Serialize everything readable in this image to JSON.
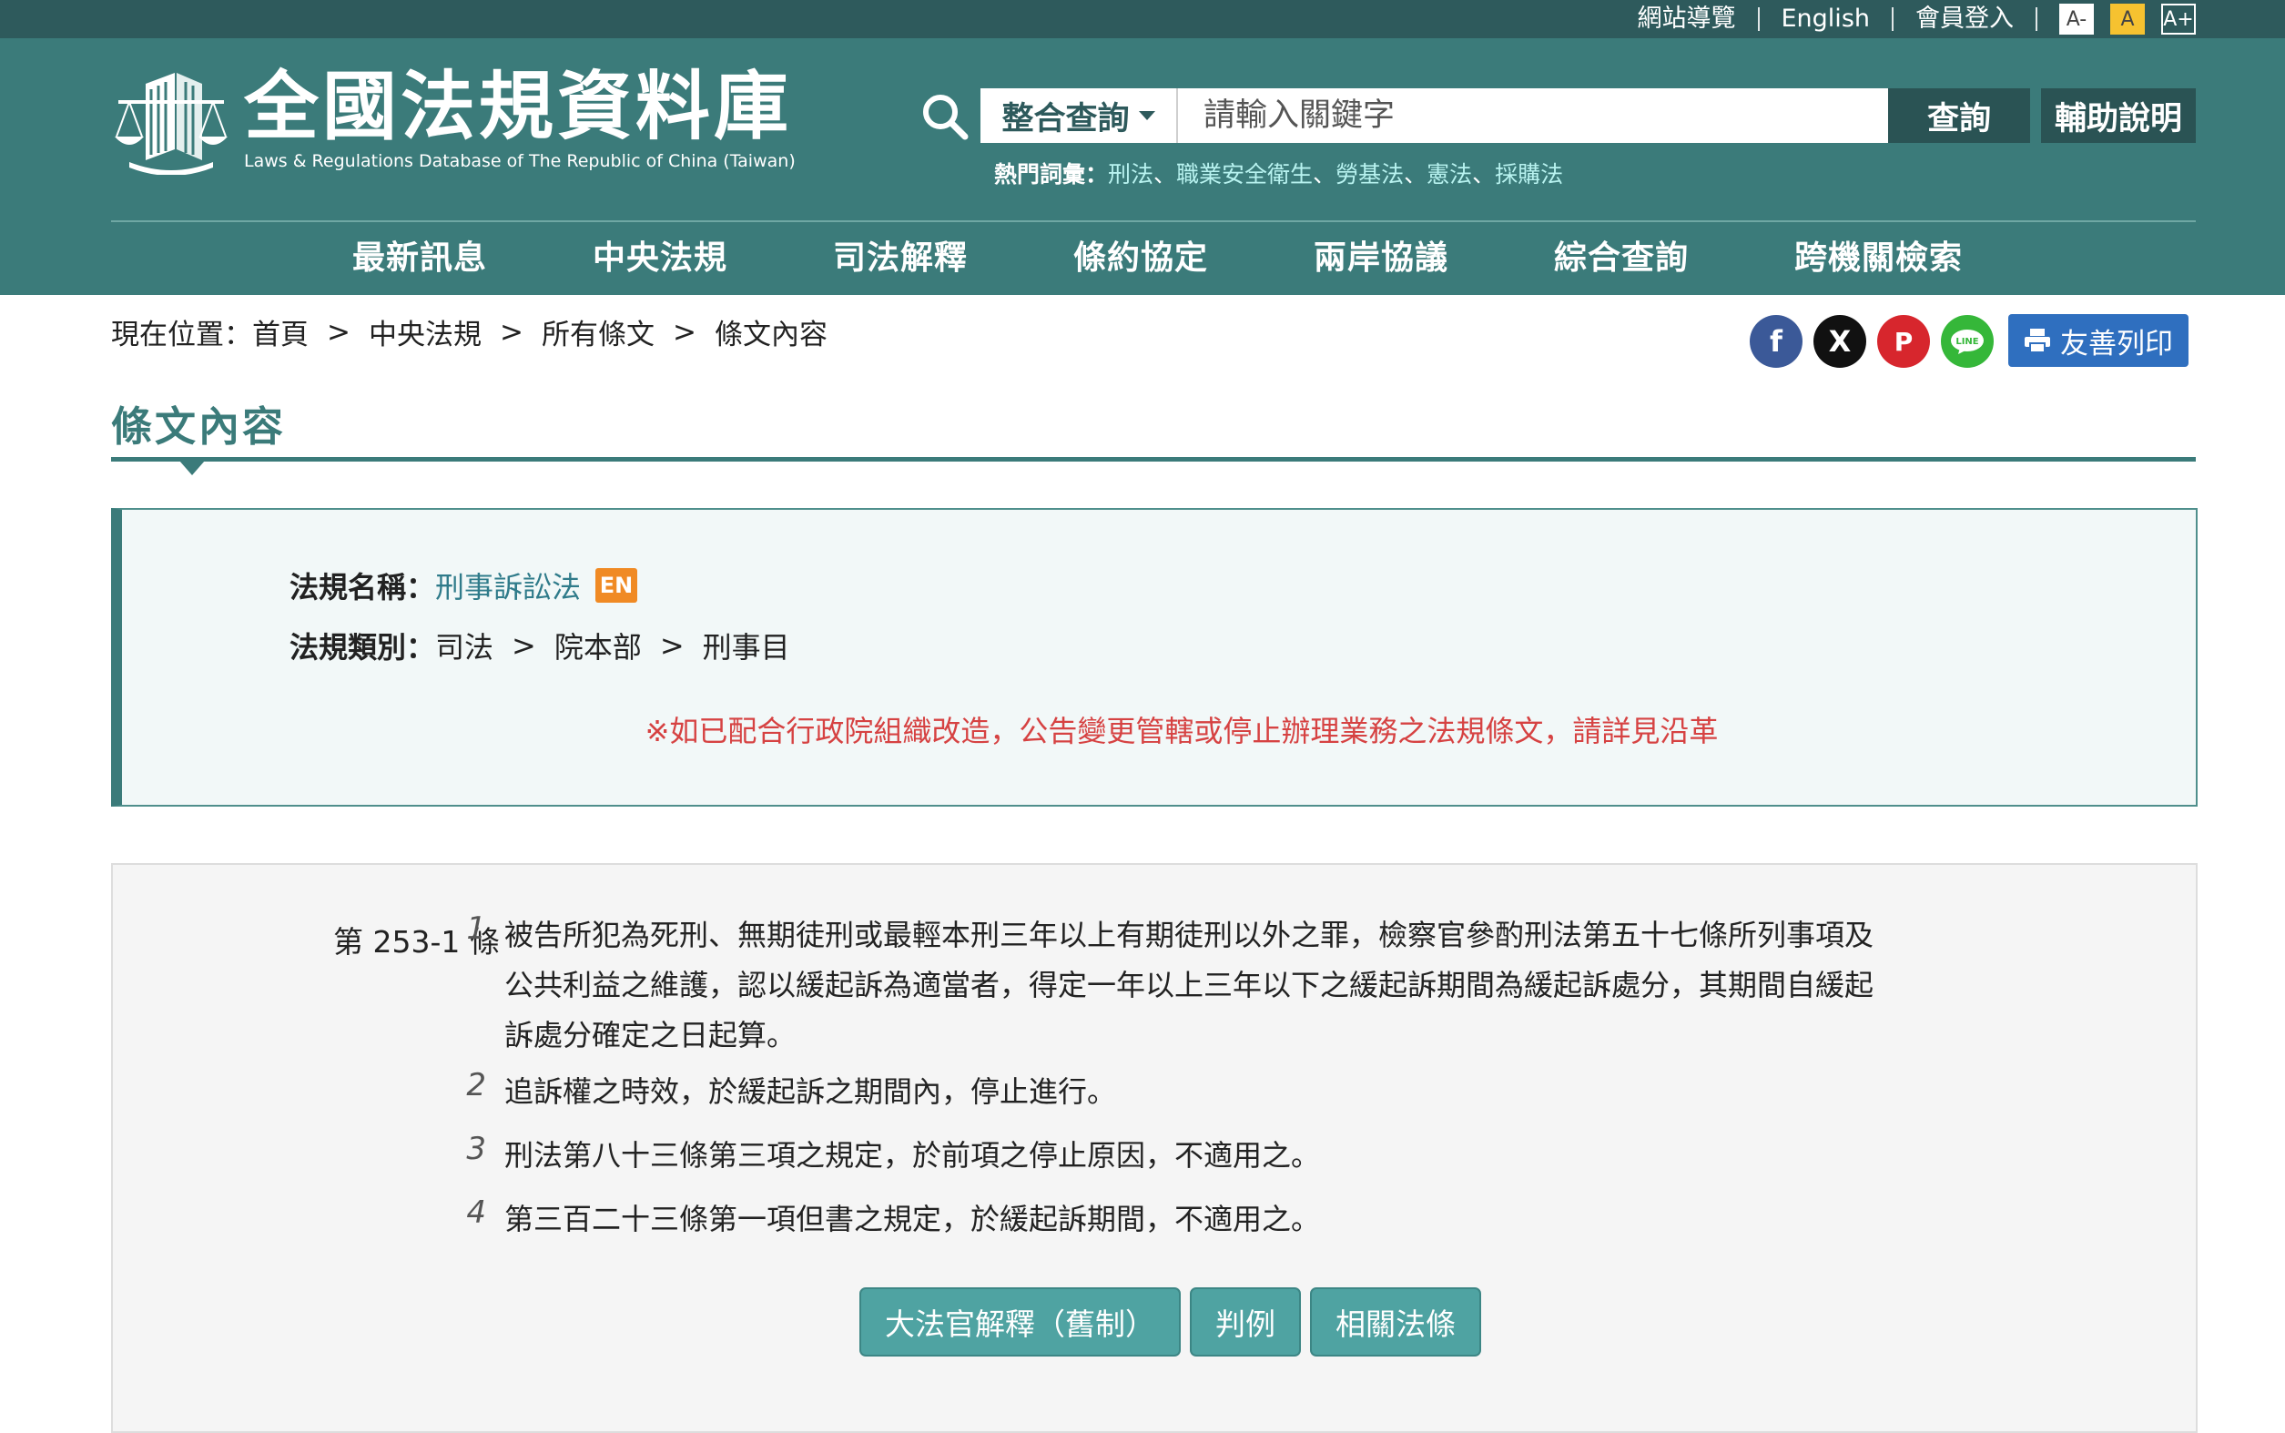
{
  "topbar": {
    "links": [
      "網站導覽",
      "English",
      "會員登入"
    ],
    "font_sizes": [
      "A-",
      "A",
      "A+"
    ]
  },
  "logo": {
    "title": "全國法規資料庫",
    "subtitle": "Laws & Regulations Database of The Republic of China (Taiwan)"
  },
  "search": {
    "icon": "search-icon",
    "scope_selected": "整合查詢",
    "placeholder": "請輸入關鍵字",
    "query_label": "查詢",
    "help_label": "輔助說明",
    "hot_label": "熱門詞彙：",
    "hot_words": [
      "刑法",
      "職業安全衛生",
      "勞基法",
      "憲法",
      "採購法"
    ],
    "hot_sep": "、"
  },
  "nav": {
    "items": [
      "最新訊息",
      "中央法規",
      "司法解釋",
      "條約協定",
      "兩岸協議",
      "綜合查詢",
      "跨機關檢索"
    ]
  },
  "breadcrumb": {
    "prefix": "現在位置：",
    "items": [
      "首頁",
      "中央法規",
      "所有條文",
      "條文內容"
    ],
    "sep": ">"
  },
  "share": {
    "icons": [
      "facebook-icon",
      "x-icon",
      "plurk-icon",
      "line-icon"
    ],
    "facebook": "f",
    "x": "X",
    "plurk": "P",
    "line": "LINE",
    "print_label": "友善列印"
  },
  "page_title": "條文內容",
  "law_info": {
    "name_label": "法規名稱：",
    "name": "刑事訴訟法",
    "en_badge": "EN",
    "category_label": "法規類別：",
    "category": [
      "司法",
      "院本部",
      "刑事目"
    ],
    "category_sep": ">",
    "notice": "※如已配合行政院組織改造，公告變更管轄或停止辦理業務之法規條文，請詳見沿革"
  },
  "article": {
    "number": "第 253-1 條",
    "paragraphs": [
      {
        "num": "1",
        "text": "被告所犯為死刑、無期徒刑或最輕本刑三年以上有期徒刑以外之罪，檢察官參酌刑法第五十七條所列事項及公共利益之維護，認以緩起訴為適當者，得定一年以上三年以下之緩起訴期間為緩起訴處分，其期間自緩起訴處分確定之日起算。"
      },
      {
        "num": "2",
        "text": "追訴權之時效，於緩起訴之期間內，停止進行。"
      },
      {
        "num": "3",
        "text": "刑法第八十三條第三項之規定，於前項之停止原因，不適用之。"
      },
      {
        "num": "4",
        "text": "第三百二十三條第一項但書之規定，於緩起訴期間，不適用之。"
      }
    ],
    "buttons": [
      "大法官解釋（舊制）",
      "判例",
      "相關法條"
    ]
  }
}
